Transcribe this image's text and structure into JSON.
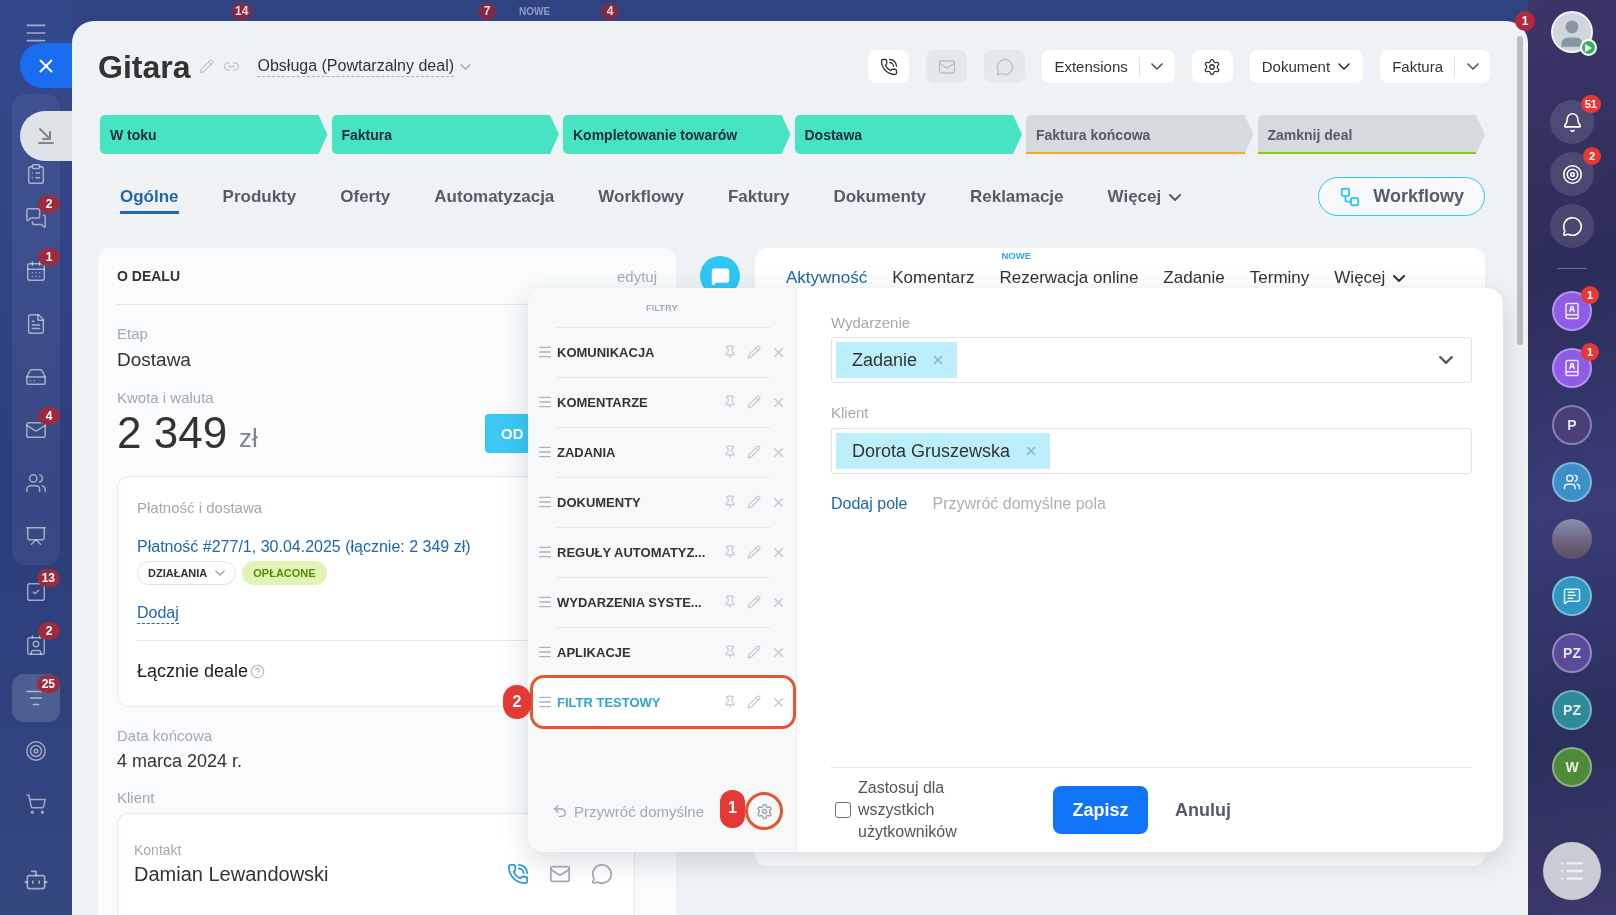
{
  "backdrop": {
    "badges": [
      {
        "kind": "count",
        "text": "14"
      },
      {
        "kind": "count",
        "text": "7"
      },
      {
        "kind": "label",
        "text": "NOWE"
      },
      {
        "kind": "count",
        "text": "4"
      }
    ]
  },
  "left_nav": {
    "items": [
      {
        "selected": false
      },
      {
        "badge": "2",
        "selected": false
      },
      {
        "badge": "1",
        "selected": false
      },
      {
        "selected": false
      },
      {
        "selected": false
      },
      {
        "badge": "4",
        "selected": false
      },
      {
        "selected": false
      },
      {
        "selected": false
      },
      {
        "badge": "13",
        "selected": false
      },
      {
        "badge": "2",
        "selected": false
      },
      {
        "badge": "25",
        "selected": true
      },
      {
        "selected": false
      },
      {
        "selected": false
      }
    ]
  },
  "deal": {
    "title": "Gitara",
    "category": "Obsługa (Powtarzalny deal)"
  },
  "toolbar": [
    {
      "kind": "icon",
      "disabled": false
    },
    {
      "kind": "icon",
      "disabled": true
    },
    {
      "kind": "icon",
      "disabled": true
    },
    {
      "kind": "split",
      "label": "Extensions"
    },
    {
      "kind": "icon",
      "disabled": false
    },
    {
      "kind": "dropdown",
      "label": "Dokument"
    },
    {
      "kind": "split",
      "label": "Faktura"
    }
  ],
  "stages": [
    {
      "label": "W toku",
      "reached": true
    },
    {
      "label": "Faktura",
      "reached": true
    },
    {
      "label": "Kompletowanie towarów",
      "reached": true
    },
    {
      "label": "Dostawa",
      "reached": true
    },
    {
      "label": "Faktura końcowa",
      "reached": false,
      "color": "#f5a623"
    },
    {
      "label": "Zamknij deal",
      "reached": false,
      "color": "#7bd500"
    }
  ],
  "tabs": [
    {
      "kind": "tab",
      "label": "Ogólne",
      "selected": true
    },
    {
      "kind": "tab",
      "label": "Produkty",
      "selected": false
    },
    {
      "kind": "tab",
      "label": "Oferty",
      "selected": false
    },
    {
      "kind": "tab",
      "label": "Automatyzacja",
      "selected": false
    },
    {
      "kind": "tab",
      "label": "Workflowy",
      "selected": false
    },
    {
      "kind": "tab",
      "label": "Faktury",
      "selected": false
    },
    {
      "kind": "tab",
      "label": "Dokumenty",
      "selected": false
    },
    {
      "kind": "tab",
      "label": "Reklamacje",
      "selected": false
    },
    {
      "kind": "menu",
      "label": "Więcej",
      "selected": false
    }
  ],
  "workflow_button": {
    "label": "Workflowy"
  },
  "about": {
    "heading": "O DEALU",
    "edit": "edytuj",
    "stage_label": "Etap",
    "stage_value": "Dostawa",
    "amount_label": "Kwota i waluta",
    "amount": "2 349",
    "currency": "zł",
    "amount_button": "OD",
    "payment": {
      "label": "Płatność i dostawa",
      "link": "Płatność #277/1, 30.04.2025 (łącznie: 2 349 zł)",
      "actions": "DZIAŁANIA",
      "status": "OPŁACONE",
      "add": "Dodaj",
      "total": "Łącznie deale"
    },
    "close_date_label": "Data końcowa",
    "close_date": "4 marca 2024 r.",
    "client_label": "Klient",
    "contact": {
      "label": "Kontakt",
      "name": "Damian Lewandowski"
    }
  },
  "timeline": {
    "tabs": [
      {
        "kind": "tab",
        "label": "Aktywność",
        "selected": true
      },
      {
        "kind": "tab",
        "label": "Komentarz",
        "selected": false
      },
      {
        "kind": "tab",
        "label": "Rezerwacja online",
        "selected": false,
        "badge": "NOWE"
      },
      {
        "kind": "tab",
        "label": "Zadanie",
        "selected": false
      },
      {
        "kind": "tab",
        "label": "Terminy",
        "selected": false
      },
      {
        "kind": "menu",
        "label": "Więcej",
        "selected": false
      }
    ]
  },
  "filters": {
    "caption": "FILTRY",
    "items": [
      {
        "label": "KOMUNIKACJA",
        "selected": false
      },
      {
        "label": "KOMENTARZE",
        "selected": false
      },
      {
        "label": "ZADANIA",
        "selected": false
      },
      {
        "label": "DOKUMENTY",
        "selected": false
      },
      {
        "label": "REGUŁY AUTOMATYZ...",
        "selected": false
      },
      {
        "label": "WYDARZENIA SYSTE...",
        "selected": false
      },
      {
        "label": "APLIKACJE",
        "selected": false
      },
      {
        "label": "FILTR TESTOWY",
        "selected": true,
        "callout": "2"
      }
    ],
    "reset": "Przywróć domyślne",
    "settings_callout": "1"
  },
  "filter_form": {
    "fields": [
      {
        "kind": "select",
        "label": "Wydarzenie",
        "tags": [
          "Zadanie"
        ]
      },
      {
        "kind": "input",
        "label": "Klient",
        "tags": [
          "Dorota Gruszewska"
        ]
      }
    ],
    "add_field": "Dodaj pole",
    "reset_fields": "Przywróć domyślne pola",
    "apply_all": {
      "label": "Zastosuj dla wszystkich użytkowników",
      "checked": false
    },
    "save": "Zapisz",
    "cancel": "Anuluj"
  },
  "right_rail": {
    "corner_badge": "1",
    "tools": [
      {
        "badge": "51"
      },
      {
        "badge": "2"
      }
    ],
    "contacts": [
      {
        "kind": "icon",
        "color": "#8e5ce6",
        "badge": "1"
      },
      {
        "kind": "icon",
        "color": "#8e5ce6",
        "badge": "1"
      },
      {
        "kind": "letters",
        "text": "P",
        "color": "#4a3f78"
      },
      {
        "kind": "icon",
        "color": "#3d8fc8"
      },
      {
        "kind": "photo"
      },
      {
        "kind": "icon",
        "color": "#2f97c2"
      },
      {
        "kind": "letters",
        "text": "PZ",
        "color": "#5a4a9a"
      },
      {
        "kind": "letters",
        "text": "PZ",
        "color": "#2f8a98"
      },
      {
        "kind": "letters",
        "text": "W",
        "color": "#4f8a3a"
      }
    ]
  }
}
